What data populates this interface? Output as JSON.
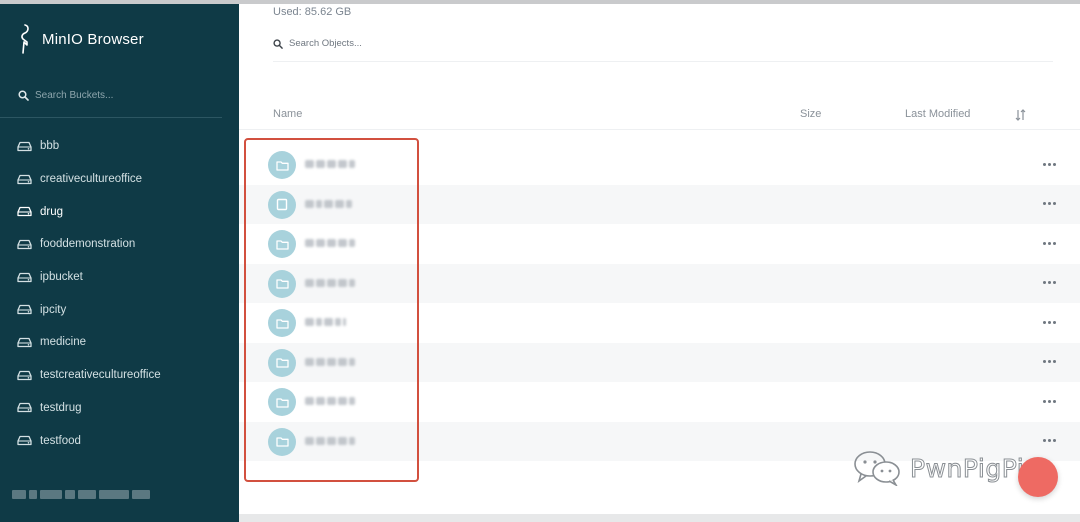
{
  "app": {
    "name": "MinIO Browser",
    "logo_icon": "minio-bird-icon"
  },
  "sidebar": {
    "search_placeholder": "Search Buckets...",
    "active_bucket": "drug",
    "buckets": [
      {
        "label": "bbb"
      },
      {
        "label": "creativecultureoffice"
      },
      {
        "label": "drug"
      },
      {
        "label": "fooddemonstration"
      },
      {
        "label": "ipbucket"
      },
      {
        "label": "ipcity"
      },
      {
        "label": "medicine"
      },
      {
        "label": "testcreativecultureoffice"
      },
      {
        "label": "testdrug"
      },
      {
        "label": "testfood"
      }
    ]
  },
  "main": {
    "used": "Used: 85.62 GB",
    "search_placeholder": "Search Objects...",
    "columns": {
      "name": "Name",
      "size": "Size",
      "last_modified": "Last Modified",
      "sort_icon": "sort-icon"
    },
    "rows": [
      {
        "type": "folder",
        "icon": "folder-icon"
      },
      {
        "type": "file",
        "icon": "file-icon"
      },
      {
        "type": "folder",
        "icon": "folder-icon"
      },
      {
        "type": "folder",
        "icon": "folder-icon"
      },
      {
        "type": "folder",
        "icon": "folder-icon"
      },
      {
        "type": "folder",
        "icon": "folder-icon"
      },
      {
        "type": "folder",
        "icon": "folder-icon"
      },
      {
        "type": "folder",
        "icon": "folder-icon"
      }
    ]
  },
  "watermark": {
    "text": "PwnPigPig",
    "icon": "wechat-icon"
  },
  "colors": {
    "sidebar": "#0f3a46",
    "icon_bg": "#a8d2dc",
    "highlight": "#d2503f",
    "fab": "#ee6a63"
  }
}
